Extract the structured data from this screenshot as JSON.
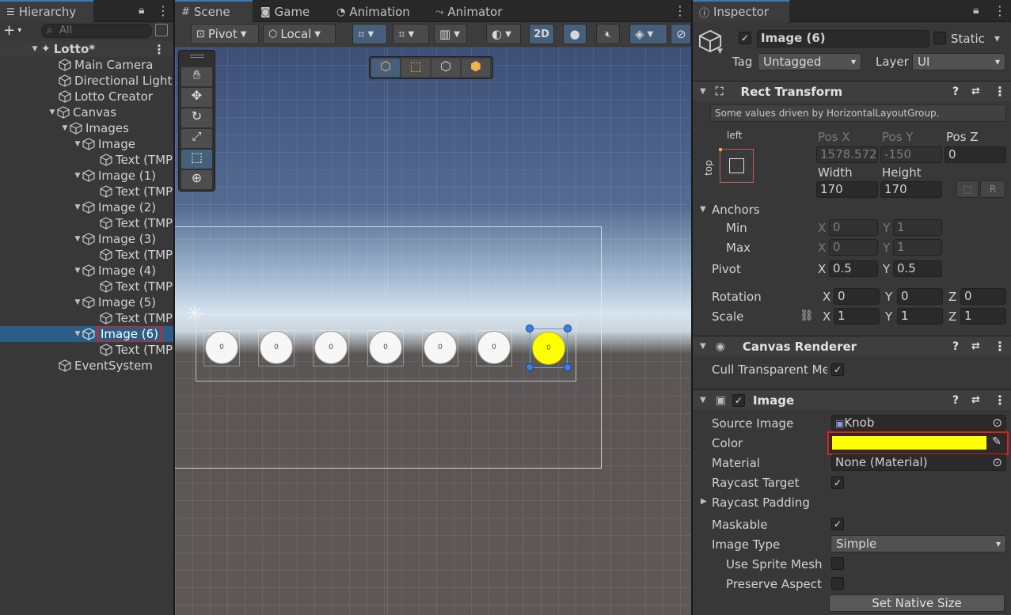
{
  "hierarchy": {
    "tab_label": "Hierarchy",
    "search_placeholder": "All",
    "items": [
      {
        "label": "Lotto*"
      },
      {
        "label": "Main Camera"
      },
      {
        "label": "Directional Light"
      },
      {
        "label": "Lotto Creator"
      },
      {
        "label": "Canvas"
      },
      {
        "label": "Images"
      },
      {
        "label": "Image"
      },
      {
        "label": "Text (TMP"
      },
      {
        "label": "Image (1)"
      },
      {
        "label": "Text (TMP"
      },
      {
        "label": "Image (2)"
      },
      {
        "label": "Text (TMP"
      },
      {
        "label": "Image (3)"
      },
      {
        "label": "Text (TMP"
      },
      {
        "label": "Image (4)"
      },
      {
        "label": "Text (TMP"
      },
      {
        "label": "Image (5)"
      },
      {
        "label": "Text (TMP"
      },
      {
        "label": "Image (6)"
      },
      {
        "label": "Text (TMP"
      },
      {
        "label": "EventSystem"
      }
    ]
  },
  "scene": {
    "tabs": [
      "Scene",
      "Game",
      "Animation",
      "Animator"
    ],
    "pivot_label": "Pivot",
    "local_label": "Local",
    "mode_2d": "2D",
    "balls": [
      "0",
      "0",
      "0",
      "0",
      "0",
      "0",
      "0"
    ],
    "selected_ball_color": "#ffff00"
  },
  "inspector": {
    "tab_label": "Inspector",
    "object_name": "Image (6)",
    "static_label": "Static",
    "tag_label": "Tag",
    "tag_value": "Untagged",
    "layer_label": "Layer",
    "layer_value": "UI",
    "rect_transform": {
      "title": "Rect Transform",
      "note": "Some values driven by HorizontalLayoutGroup.",
      "anchor_h": "left",
      "anchor_v": "top",
      "pos_x_label": "Pos X",
      "pos_x": "1578.572",
      "pos_y_label": "Pos Y",
      "pos_y": "-150",
      "pos_z_label": "Pos Z",
      "pos_z": "0",
      "width_label": "Width",
      "width": "170",
      "height_label": "Height",
      "height": "170",
      "anchors_label": "Anchors",
      "min_label": "Min",
      "min_x": "0",
      "min_y": "1",
      "max_label": "Max",
      "max_x": "0",
      "max_y": "1",
      "pivot_label": "Pivot",
      "pivot_x": "0.5",
      "pivot_y": "0.5",
      "rotation_label": "Rotation",
      "rot_x": "0",
      "rot_y": "0",
      "rot_z": "0",
      "scale_label": "Scale",
      "scale_x": "1",
      "scale_y": "1",
      "scale_z": "1",
      "x": "X",
      "y": "Y",
      "z": "Z",
      "r_btn": "R"
    },
    "canvas_renderer": {
      "title": "Canvas Renderer",
      "cull_label": "Cull Transparent Mes"
    },
    "image": {
      "title": "Image",
      "source_label": "Source Image",
      "source_value": "Knob",
      "color_label": "Color",
      "color_value": "#ffff00",
      "material_label": "Material",
      "material_value": "None (Material)",
      "raycast_label": "Raycast Target",
      "raycast_padding_label": "Raycast Padding",
      "maskable_label": "Maskable",
      "image_type_label": "Image Type",
      "image_type_value": "Simple",
      "sprite_mesh_label": "Use Sprite Mesh",
      "preserve_label": "Preserve Aspect",
      "native_btn": "Set Native Size"
    }
  }
}
